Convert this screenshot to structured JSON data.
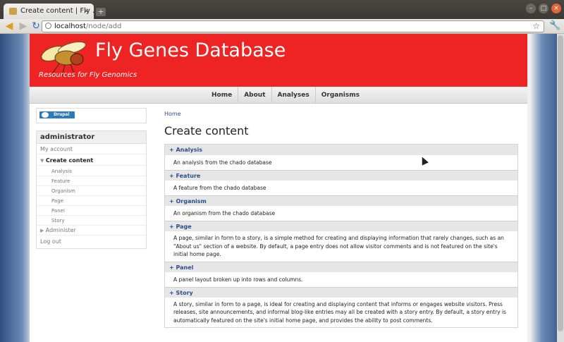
{
  "browser": {
    "tab_title": "Create content | Fly ...",
    "tab_close": "×",
    "new_tab": "+",
    "url_host": "localhost",
    "url_path": "/node/add",
    "window_buttons": [
      "–",
      "□",
      "×"
    ],
    "icons": [
      "back-icon",
      "forward-icon",
      "reload-icon",
      "star-icon",
      "wrench-icon"
    ]
  },
  "site": {
    "name": "Fly Genes Database",
    "slogan": "Resources for Fly Genomics",
    "brand_color": "#ee2323"
  },
  "primary_nav": [
    "Home",
    "About",
    "Analyses",
    "Organisms"
  ],
  "sidebar": {
    "drupal_badge": "Drupal",
    "user_block_title": "administrator",
    "items": [
      {
        "label": "My account",
        "level": "top"
      },
      {
        "label": "Create content",
        "level": "top",
        "active": true,
        "expanded": true
      },
      {
        "label": "Analysis",
        "level": "sub"
      },
      {
        "label": "Feature",
        "level": "sub"
      },
      {
        "label": "Organism",
        "level": "sub"
      },
      {
        "label": "Page",
        "level": "sub"
      },
      {
        "label": "Panel",
        "level": "sub"
      },
      {
        "label": "Story",
        "level": "sub"
      },
      {
        "label": "Administer",
        "level": "top",
        "collapsed": true
      },
      {
        "label": "Log out",
        "level": "top"
      }
    ]
  },
  "main": {
    "breadcrumb": "Home",
    "title": "Create content",
    "content_types": [
      {
        "name": "+ Analysis",
        "description": "An analysis from the chado database"
      },
      {
        "name": "+ Feature",
        "description": "A feature from the chado database"
      },
      {
        "name": "+ Organism",
        "description": "An organism from the chado database"
      },
      {
        "name": "+ Page",
        "description": "A page, similar in form to a story, is a simple method for creating and displaying information that rarely changes, such as an \"About us\" section of a website. By default, a page entry does not allow visitor comments and is not featured on the site's initial home page."
      },
      {
        "name": "+ Panel",
        "description": "A panel layout broken up into rows and columns."
      },
      {
        "name": "+ Story",
        "description": "A story, similar in form to a page, is ideal for creating and displaying content that informs or engages website visitors. Press releases, site announcements, and informal blog-like entries may all be created with a story entry. By default, a story entry is automatically featured on the site's initial home page, and provides the ability to post comments."
      }
    ]
  }
}
